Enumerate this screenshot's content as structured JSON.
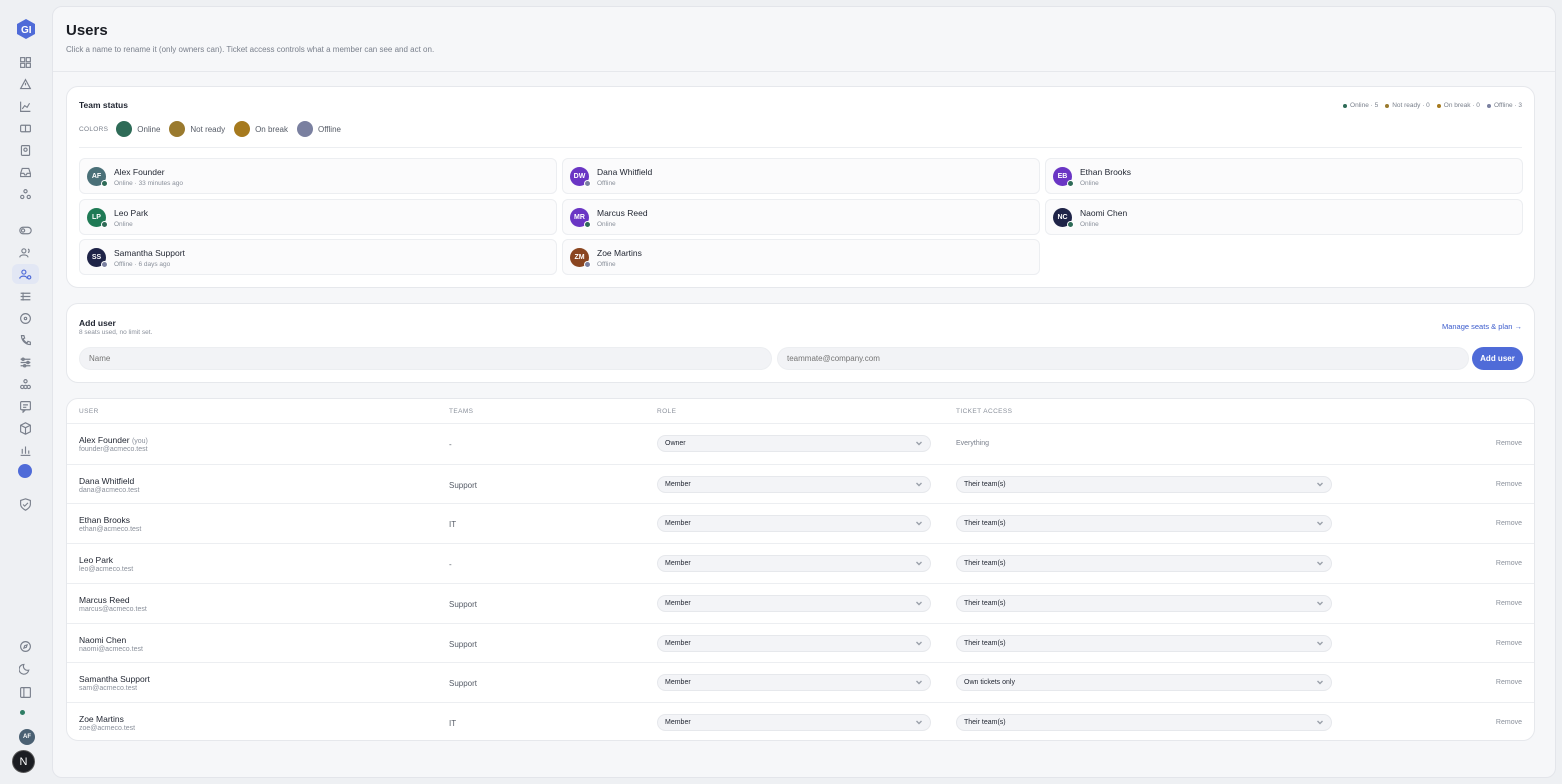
{
  "page": {
    "title": "Users",
    "subtitle": "Click a name to rename it (only owners can). Ticket access controls what a member can see and act on."
  },
  "rail": {
    "avatar_initials": "AF",
    "bottom_logo": "N",
    "icons": [
      "grid-icon",
      "alert-icon",
      "chart-icon",
      "ticket-icon",
      "contacts-icon",
      "inbox-icon",
      "integrations-icon",
      "toggle-icon",
      "users-icon",
      "user-settings-icon",
      "list-icon",
      "target-icon",
      "phone-icon",
      "sliders-icon",
      "apps-icon",
      "chat-icon",
      "box-icon",
      "bar-chart-icon",
      "status-dot",
      "shield-icon",
      "compass-icon",
      "moon-icon",
      "sidebar-icon"
    ]
  },
  "team_status": {
    "title": "Team status",
    "counts": [
      {
        "label": "Online · 5",
        "color": "#2e6b57"
      },
      {
        "label": "Not ready · 0",
        "color": "#9a7a2e"
      },
      {
        "label": "On break · 0",
        "color": "#a67a1e"
      },
      {
        "label": "Offline · 3",
        "color": "#7a80a0"
      }
    ],
    "colors_label": "COLORS",
    "legend": [
      {
        "label": "Online",
        "color": "#2e6b57"
      },
      {
        "label": "Not ready",
        "color": "#9a7a2e"
      },
      {
        "label": "On break",
        "color": "#a67a1e"
      },
      {
        "label": "Offline",
        "color": "#7a80a0"
      }
    ],
    "members": [
      {
        "initials": "AF",
        "name": "Alex Founder",
        "status": "Online · 33 minutes ago",
        "avatar_color": "#4a7078",
        "dot_color": "#2e6b57"
      },
      {
        "initials": "DW",
        "name": "Dana Whitfield",
        "status": "Offline",
        "avatar_color": "#6a35c4",
        "dot_color": "#7a80a0"
      },
      {
        "initials": "EB",
        "name": "Ethan Brooks",
        "status": "Online",
        "avatar_color": "#6a35c4",
        "dot_color": "#2e6b57"
      },
      {
        "initials": "LP",
        "name": "Leo Park",
        "status": "Online",
        "avatar_color": "#1f7a55",
        "dot_color": "#2e6b57"
      },
      {
        "initials": "MR",
        "name": "Marcus Reed",
        "status": "Online",
        "avatar_color": "#6a35c4",
        "dot_color": "#2e6b57"
      },
      {
        "initials": "NC",
        "name": "Naomi Chen",
        "status": "Online",
        "avatar_color": "#1f2448",
        "dot_color": "#2e6b57"
      },
      {
        "initials": "SS",
        "name": "Samantha Support",
        "status": "Offline · 6 days ago",
        "avatar_color": "#1f2448",
        "dot_color": "#7a80a0"
      },
      {
        "initials": "ZM",
        "name": "Zoe Martins",
        "status": "Offline",
        "avatar_color": "#8a4520",
        "dot_color": "#7a80a0"
      }
    ]
  },
  "add_user": {
    "title": "Add user",
    "subtitle": "8 seats used, no limit set.",
    "manage_link": "Manage seats & plan →",
    "name_placeholder": "Name",
    "email_placeholder": "teammate@company.com",
    "button": "Add user"
  },
  "table": {
    "headers": {
      "user": "USER",
      "teams": "TEAMS",
      "role": "ROLE",
      "access": "TICKET ACCESS"
    },
    "rows": [
      {
        "name": "Alex Founder",
        "you": "(you)",
        "email": "founder@acmeco.test",
        "teams": "-",
        "role": "Owner",
        "access": "Everything",
        "remove": "Remove"
      },
      {
        "name": "Dana Whitfield",
        "you": "",
        "email": "dana@acmeco.test",
        "teams": "Support",
        "role": "Member",
        "access": "Their team(s)",
        "remove": "Remove"
      },
      {
        "name": "Ethan Brooks",
        "you": "",
        "email": "ethan@acmeco.test",
        "teams": "IT",
        "role": "Member",
        "access": "Their team(s)",
        "remove": "Remove"
      },
      {
        "name": "Leo Park",
        "you": "",
        "email": "leo@acmeco.test",
        "teams": "-",
        "role": "Member",
        "access": "Their team(s)",
        "remove": "Remove"
      },
      {
        "name": "Marcus Reed",
        "you": "",
        "email": "marcus@acmeco.test",
        "teams": "Support",
        "role": "Member",
        "access": "Their team(s)",
        "remove": "Remove"
      },
      {
        "name": "Naomi Chen",
        "you": "",
        "email": "naomi@acmeco.test",
        "teams": "Support",
        "role": "Member",
        "access": "Their team(s)",
        "remove": "Remove"
      },
      {
        "name": "Samantha Support",
        "you": "",
        "email": "sam@acmeco.test",
        "teams": "Support",
        "role": "Member",
        "access": "Own tickets only",
        "remove": "Remove"
      },
      {
        "name": "Zoe Martins",
        "you": "",
        "email": "zoe@acmeco.test",
        "teams": "IT",
        "role": "Member",
        "access": "Their team(s)",
        "remove": "Remove"
      }
    ]
  }
}
